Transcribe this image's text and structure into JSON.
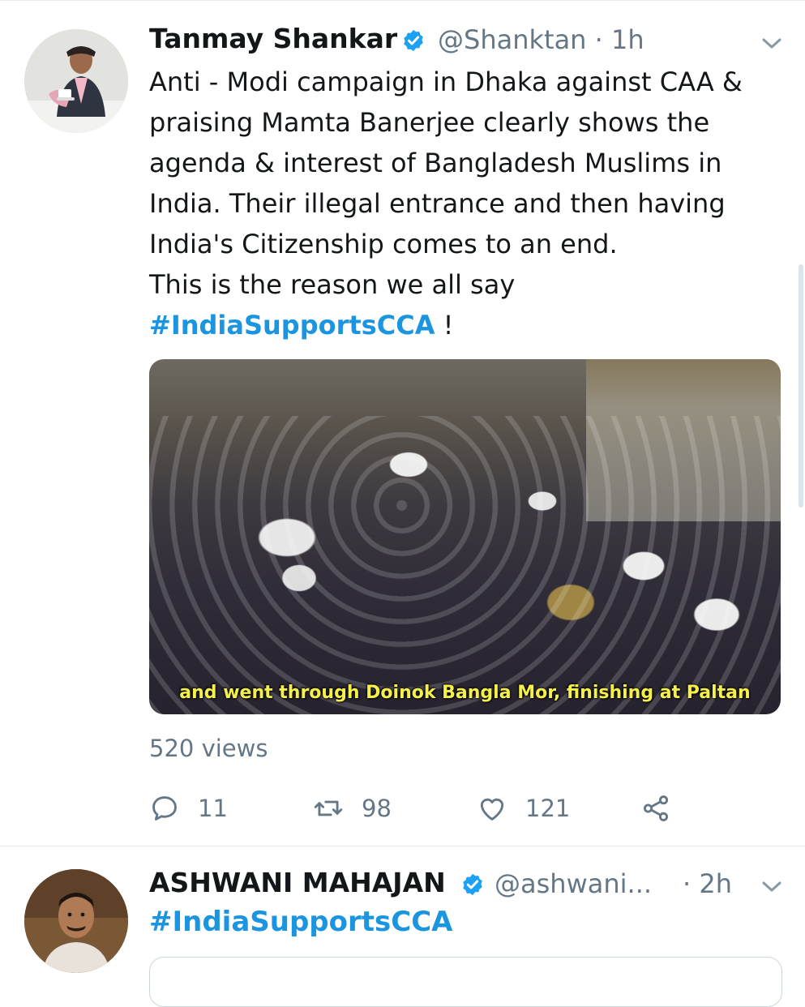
{
  "tweets": [
    {
      "name": "Tanmay Shankar",
      "handle": "@Shanktan",
      "time": "· 1h",
      "text_lines": [
        "Anti - Modi campaign in Dhaka against CAA &",
        "praising Mamta Banerjee clearly shows the",
        "agenda & interest of Bangladesh Muslims in",
        "India. Their illegal entrance and then having",
        "India's Citizenship comes to an end.",
        "This is the reason we all say"
      ],
      "hashtag": "#IndiaSupportsCCA",
      "hashtag_suffix": " !",
      "video_caption": "and went through Doinok Bangla Mor, finishing at Paltan",
      "views": "520 views",
      "replies": "11",
      "retweets": "98",
      "likes": "121"
    },
    {
      "name": "ASHWANI MAHAJAN",
      "handle": "@ashwani...",
      "time": "· 2h",
      "hashtag": "#IndiaSupportsCCA"
    }
  ],
  "colors": {
    "verified": "#1da1f2",
    "hashtag": "#1b95e0",
    "secondary_text": "#657786",
    "caption": "#f5f04a"
  },
  "icons": [
    "verified-badge-icon",
    "chevron-down-icon",
    "reply-icon",
    "retweet-icon",
    "like-icon",
    "share-icon"
  ]
}
